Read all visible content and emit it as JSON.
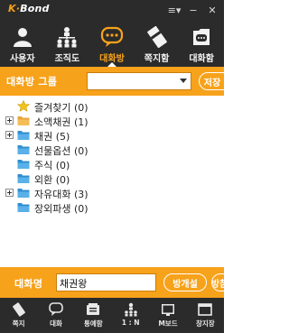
{
  "app": {
    "logo_prefix": "K",
    "logo_suffix": "Bond",
    "menu_glyph": "≡▾",
    "minimize_glyph": "−",
    "close_glyph": "✕"
  },
  "nav": {
    "items": [
      {
        "label": "사용자",
        "icon": "user-icon"
      },
      {
        "label": "조직도",
        "icon": "org-chart-icon"
      },
      {
        "label": "대화방",
        "icon": "chat-room-icon",
        "active": true
      },
      {
        "label": "쪽지함",
        "icon": "note-box-icon"
      },
      {
        "label": "대화함",
        "icon": "chat-archive-icon"
      }
    ]
  },
  "group": {
    "label": "대화방 그룹",
    "select_value": "",
    "save_label": "저장"
  },
  "tree": {
    "items": [
      {
        "label": "즐겨찾기 (0)",
        "icon": "star-icon",
        "expandable": false
      },
      {
        "label": "소액채권 (1)",
        "icon": "folder-icon",
        "expandable": true
      },
      {
        "label": "채권 (5)",
        "icon": "folder-icon",
        "expandable": true
      },
      {
        "label": "선물옵션 (0)",
        "icon": "folder-icon",
        "expandable": false
      },
      {
        "label": "주식 (0)",
        "icon": "folder-icon",
        "expandable": false
      },
      {
        "label": "외환 (0)",
        "icon": "folder-icon",
        "expandable": false
      },
      {
        "label": "자유대화 (3)",
        "icon": "folder-icon",
        "expandable": true
      },
      {
        "label": "장외파생 (0)",
        "icon": "folder-icon",
        "expandable": false
      }
    ]
  },
  "room": {
    "label": "대화명",
    "name_value": "채권왕",
    "open_label": "방개설",
    "join_label": "방참"
  },
  "bottom": {
    "items": [
      {
        "label": "쪽지",
        "icon": "note-icon"
      },
      {
        "label": "대화",
        "icon": "chat-icon"
      },
      {
        "label": "통예함",
        "icon": "contacts-icon"
      },
      {
        "label": "1 : N",
        "icon": "one-to-many-icon"
      },
      {
        "label": "M보드",
        "icon": "m-board-icon"
      },
      {
        "label": "창지장",
        "icon": "window-icon"
      }
    ]
  },
  "colors": {
    "accent": "#f7a21b",
    "dark": "#2b2b2b",
    "folder": "#4aa3df",
    "folder_open": "#e8a53a",
    "star": "#f2c31a"
  }
}
